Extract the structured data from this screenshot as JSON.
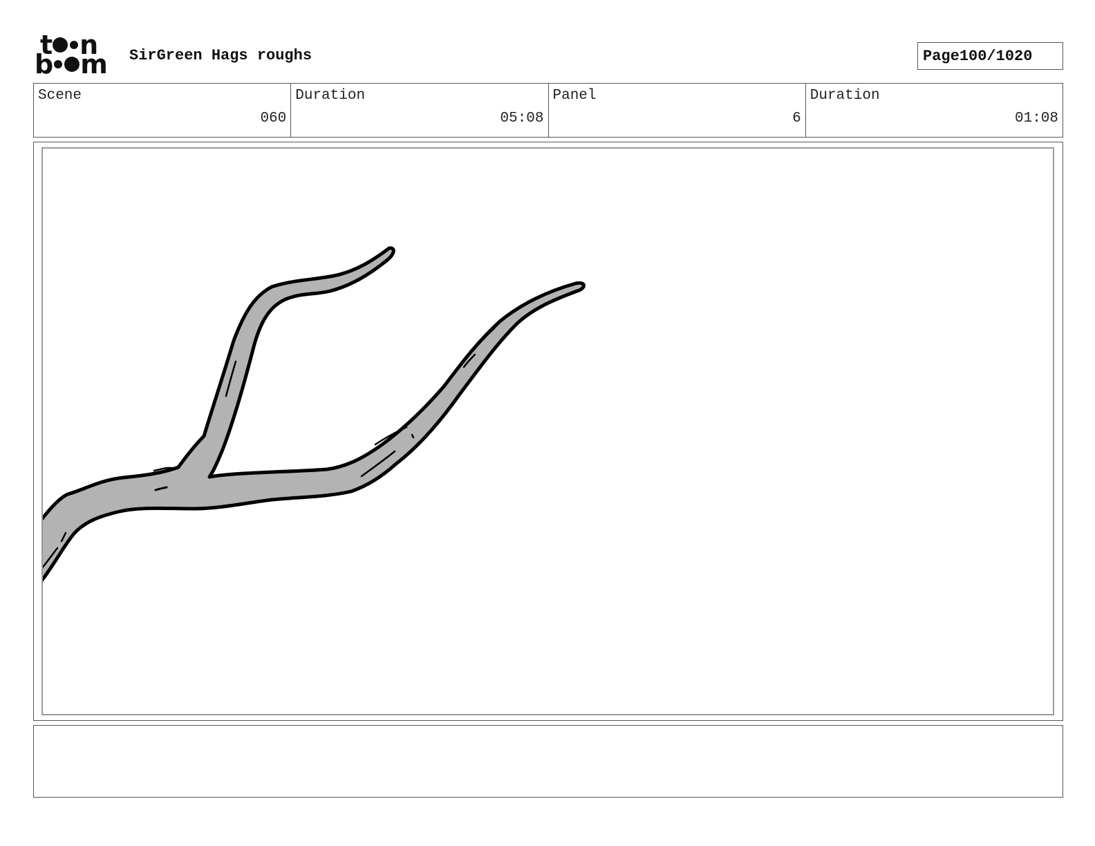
{
  "header": {
    "logo_alt": "toon boom",
    "title": "SirGreen Hags roughs",
    "page_label": "Page",
    "page_number": "100/1020"
  },
  "info": {
    "scene_label": "Scene",
    "scene_value": "060",
    "scene_duration_label": "Duration",
    "scene_duration_value": "05:08",
    "panel_label": "Panel",
    "panel_value": "6",
    "panel_duration_label": "Duration",
    "panel_duration_value": "01:08"
  },
  "panel": {
    "drawing": "branch-drawing",
    "colors": {
      "branch_fill": "#b3b3b3",
      "branch_outline": "#000000"
    }
  },
  "notes": {
    "text": ""
  }
}
